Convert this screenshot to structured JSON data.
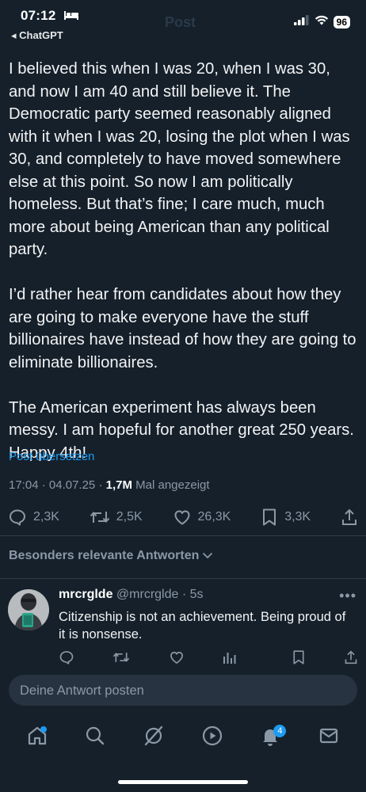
{
  "status_bar": {
    "time": "07:12",
    "back_label": "◂ ChatGPT",
    "battery": "96",
    "ghost_title": "Post"
  },
  "post": {
    "paragraphs": [
      "I believed this when I was 20, when I was 30, and now I am 40 and still believe it. The Democratic party seemed reasonably aligned with it when I was 20, losing the plot when I was 30, and completely to have moved somewhere else at this point. So now I am politically homeless. But that’s fine; I care much, much more about being American than any political party.",
      "I’d rather hear from candidates about how they are going to make everyone have the stuff billionaires have instead of how they are going to eliminate billionaires.",
      "The American experiment has always been messy. I am hopeful for another great 250 years. Happy 4th!"
    ],
    "translate_label": "Post übersetzen",
    "time": "17:04",
    "date": "04.07.25",
    "views": "1,7M",
    "views_label": "Mal angezeigt",
    "replies": "2,3K",
    "reposts": "2,5K",
    "likes": "26,3K",
    "bookmarks": "3,3K"
  },
  "replies_section": {
    "sort_label": "Besonders relevante Antworten"
  },
  "reply": {
    "name": "mrcrglde",
    "handle": "@mrcrglde",
    "age": "5s",
    "text": "Citizenship is not an achievement. Being proud of it is nonsense."
  },
  "compose": {
    "placeholder": "Deine Antwort posten"
  },
  "tabbar": {
    "notifications_count": "4"
  },
  "colors": {
    "background": "#15202b",
    "accent": "#1d9bf0",
    "secondary_text": "#8b98a5"
  },
  "icons": [
    "bed-icon",
    "signal-icon",
    "wifi-icon",
    "reply-icon",
    "repost-icon",
    "like-icon",
    "bookmark-icon",
    "share-icon",
    "views-icon",
    "home-icon",
    "search-icon",
    "grok-icon",
    "video-icon",
    "bell-icon",
    "mail-icon"
  ]
}
